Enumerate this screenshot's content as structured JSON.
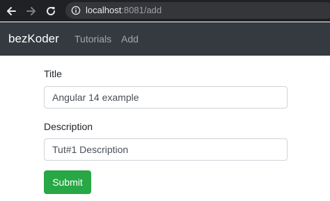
{
  "browser": {
    "url_host": "localhost",
    "url_rest": ":8081/add",
    "icons": {
      "back": "arrow-left-icon",
      "forward": "arrow-right-icon",
      "reload": "reload-icon",
      "site_info": "info-icon"
    }
  },
  "navbar": {
    "brand": "bezKoder",
    "links": [
      {
        "label": "Tutorials"
      },
      {
        "label": "Add"
      }
    ],
    "background_color": "#343a40"
  },
  "form": {
    "title_label": "Title",
    "title_value": "Angular 14 example",
    "description_label": "Description",
    "description_value": "Tut#1 Description",
    "submit_label": "Submit",
    "submit_color": "#28a745"
  }
}
